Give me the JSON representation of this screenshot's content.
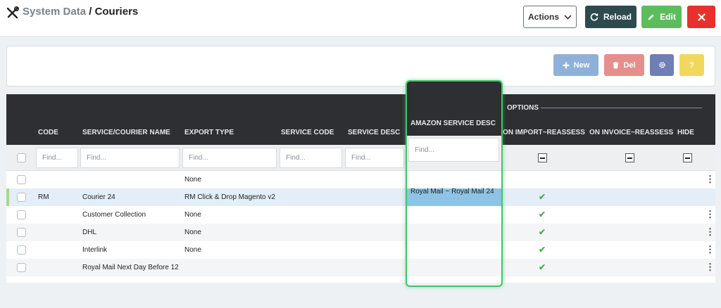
{
  "header": {
    "title_parent": "System Data",
    "title_sep": " / ",
    "title_current": "Couriers",
    "actions_label": "Actions",
    "reload_label": "Reload",
    "edit_label": "Edit"
  },
  "toolbar": {
    "new_label": "New",
    "del_label": "Del",
    "help_label": "?"
  },
  "table": {
    "group_header": "OPTIONS",
    "columns": {
      "code": "CODE",
      "name": "SERVICE/COURIER NAME",
      "export": "EXPORT TYPE",
      "service_code": "SERVICE CODE",
      "service_desc": "SERVICE DESC",
      "amazon": "AMAZON SERVICE DESC",
      "import_reassess": "ON IMPORT~REASSESS",
      "invoice_reassess": "ON INVOICE~REASSESS",
      "hide": "HIDE"
    },
    "filter_placeholder": "Find...",
    "rows": [
      {
        "code": "",
        "name": "",
        "export": "None",
        "amazon": "",
        "import_reassess": false
      },
      {
        "code": "RM",
        "name": "Courier 24",
        "export": "RM Click & Drop Magento v2",
        "amazon": "Royal Mail ~ Royal Mail 24",
        "import_reassess": true
      },
      {
        "code": "",
        "name": "Customer Collection",
        "export": "None",
        "amazon": "",
        "import_reassess": true
      },
      {
        "code": "",
        "name": "DHL",
        "export": "None",
        "amazon": "",
        "import_reassess": true
      },
      {
        "code": "",
        "name": "Interlink",
        "export": "None",
        "amazon": "",
        "import_reassess": true
      },
      {
        "code": "",
        "name": "Royal Mail Next Day Before 12",
        "export": "",
        "amazon": "",
        "import_reassess": true
      }
    ]
  },
  "colors": {
    "header_dark": "#2d2f33",
    "selected_row": "#e3eef8",
    "amazon_highlight": "#8ec3e4",
    "check": "#4caf50",
    "focus_outline": "#43c36a"
  }
}
